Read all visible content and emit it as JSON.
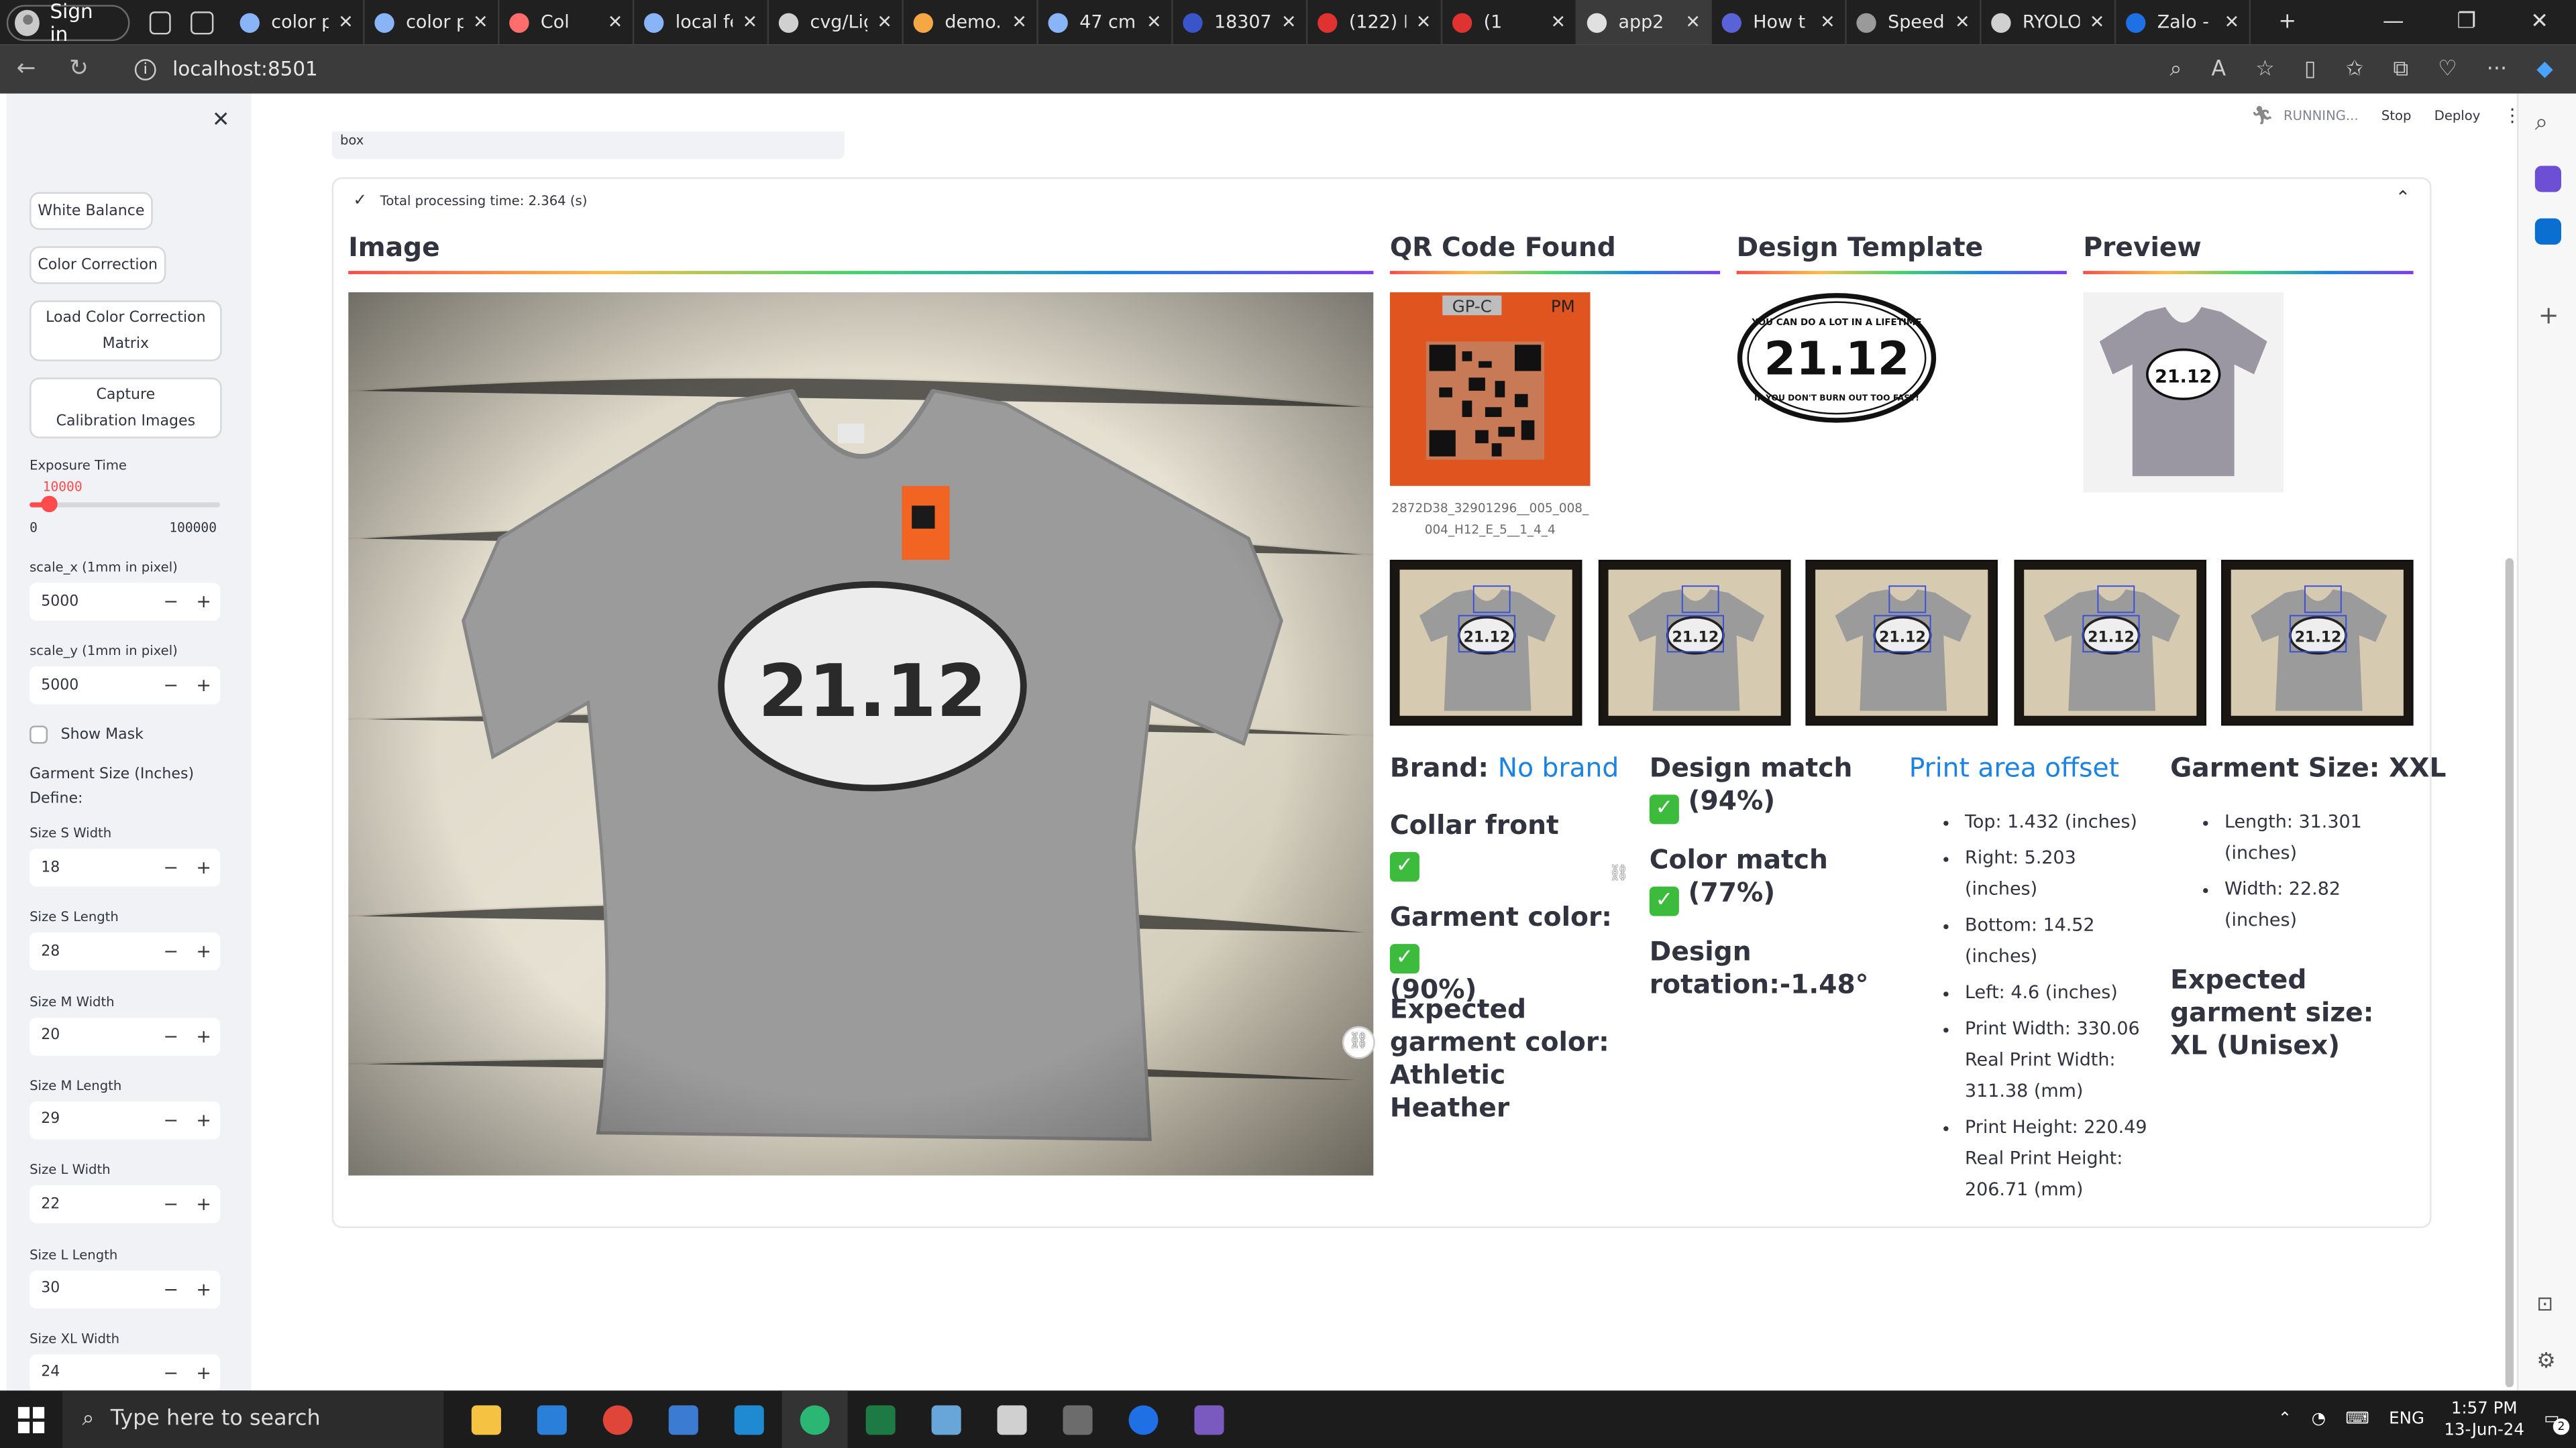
{
  "browser": {
    "signin_label": "Sign in",
    "tabs": [
      {
        "label": "color p",
        "color": "#8ab4f8"
      },
      {
        "label": "color p",
        "color": "#8ab4f8"
      },
      {
        "label": "Col",
        "color": "#ff6d6d"
      },
      {
        "label": "local fe",
        "color": "#8ab4f8"
      },
      {
        "label": "cvg/Lig",
        "color": "#d0d0d0"
      },
      {
        "label": "demo.",
        "color": "#f4a742"
      },
      {
        "label": "47 cm",
        "color": "#8ab4f8"
      },
      {
        "label": "18307",
        "color": "#3a55c9"
      },
      {
        "label": "(122) F",
        "color": "#e13232"
      },
      {
        "label": "(1",
        "color": "#e13232"
      },
      {
        "label": "app2",
        "color": "#e0e0e0"
      },
      {
        "label": "How t",
        "color": "#5a62d8"
      },
      {
        "label": "Speed",
        "color": "#9a9a9a"
      },
      {
        "label": "RYOLO",
        "color": "#d0d0d0"
      },
      {
        "label": "Zalo -",
        "color": "#1f6fe5"
      }
    ],
    "url": "localhost:8501"
  },
  "streamlit": {
    "status": "RUNNING...",
    "stop": "Stop",
    "deploy": "Deploy"
  },
  "sidebar": {
    "buttons": [
      "White Balance",
      "Color Correction",
      "Load Color Correction Matrix",
      "Capture Calibration Images"
    ],
    "exposure_label": "Exposure Time",
    "exposure_value": "10000",
    "exposure_min": "0",
    "exposure_max": "100000",
    "exposure_fraction": 0.1,
    "scale_x_label": "scale_x (1mm in pixel)",
    "scale_x_value": "5000",
    "scale_y_label": "scale_y (1mm in pixel)",
    "scale_y_value": "5000",
    "show_mask": "Show Mask",
    "garment_size_title": "Garment Size (Inches)",
    "define": "Define:",
    "sizes": [
      {
        "label": "Size S Width",
        "value": "18"
      },
      {
        "label": "Size S Length",
        "value": "28"
      },
      {
        "label": "Size M Width",
        "value": "20"
      },
      {
        "label": "Size M Length",
        "value": "29"
      },
      {
        "label": "Size L Width",
        "value": "22"
      },
      {
        "label": "Size L Length",
        "value": "30"
      },
      {
        "label": "Size XL Width",
        "value": "24"
      }
    ]
  },
  "main": {
    "top_input_text": "box",
    "processing_time": "Total processing time: 2.364 (s)",
    "headers": {
      "image": "Image",
      "qr": "QR Code Found",
      "template": "Design Template",
      "preview": "Preview"
    },
    "qr_code_text": "2872D38_32901296__005_008_004_H12_E_5__1_4_4",
    "qr_tag_text": "GP-C",
    "qr_tag_pm": "PM",
    "design_number": "21.12",
    "design_top": "YOU CAN DO A LOT IN A LIFETIME",
    "design_bottom": "IF YOU DON'T BURN OUT TOO FAST!",
    "brand_label": "Brand:",
    "brand_value": "No brand",
    "collar_front": "Collar front",
    "garment_color": "Garment color:",
    "garment_color_pct": "(90%)",
    "expected_color": "Expected garment color: Athletic Heather",
    "design_match": "Design match",
    "design_match_pct": "(94%)",
    "color_match": "Color match",
    "color_match_pct": "(77%)",
    "design_rotation": "Design rotation:-1.48°",
    "print_offset_title": "Print area offset",
    "print_offset": [
      "Top: 1.432 (inches)",
      "Right: 5.203 (inches)",
      "Bottom: 14.52 (inches)",
      "Left: 4.6 (inches)",
      "Print Width: 330.06 Real Print Width: 311.38 (mm)",
      "Print Height: 220.49 Real Print Height: 206.71 (mm)"
    ],
    "garment_size_title": "Garment Size: XXL",
    "garment_size": [
      "Length: 31.301 (inches)",
      "Width: 22.82 (inches)"
    ],
    "expected_size": "Expected garment size: XL (Unisex)"
  },
  "taskbar": {
    "search_placeholder": "Type here to search",
    "time": "1:57 PM",
    "date": "13-Jun-24",
    "lang": "ENG",
    "notif_count": "2"
  },
  "colors": {
    "accent": "#ff4b4b",
    "link_blue": "#1c83e1",
    "check_green": "#3dbb3d",
    "shirt_grey": "#9b9b9b"
  }
}
